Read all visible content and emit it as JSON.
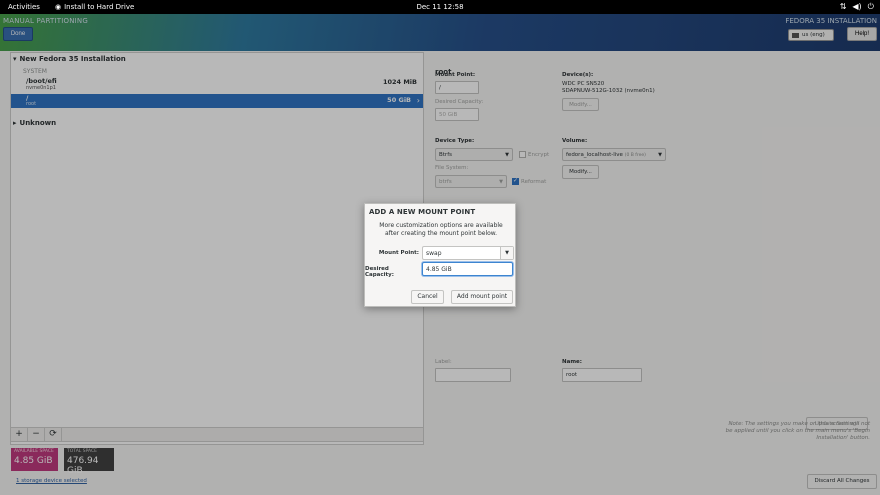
{
  "topbar": {
    "activities": "Activities",
    "app_name": "Install to Hard Drive",
    "clock": "Dec 11  12:58",
    "icons": [
      "network-icon",
      "volume-icon",
      "power-icon"
    ]
  },
  "header": {
    "section_title": "MANUAL PARTITIONING",
    "done_label": "Done",
    "product_title": "FEDORA 35 INSTALLATION",
    "keyboard_layout": "us (eng)",
    "help_label": "Help!"
  },
  "tree": {
    "install_title": "New Fedora 35 Installation",
    "system_label": "SYSTEM",
    "partitions": [
      {
        "mount": "/boot/efi",
        "device": "nvme0n1p1",
        "size": "1024 MiB"
      },
      {
        "mount": "/",
        "device": "root",
        "size": "50 GiB"
      }
    ],
    "unknown_label": "Unknown"
  },
  "toolbar": {
    "add": "+",
    "remove": "−",
    "refresh": "⟳"
  },
  "space": {
    "available_label": "AVAILABLE SPACE",
    "available_value": "4.85 GiB",
    "total_label": "TOTAL SPACE",
    "total_value": "476.94 GiB"
  },
  "storage_link": "1 storage device selected",
  "details": {
    "title": "root",
    "mount_point_label": "Mount Point:",
    "mount_point_value": "/",
    "desired_capacity_label": "Desired Capacity:",
    "desired_capacity_value": "50 GiB",
    "devices_label": "Device(s):",
    "devices_line1": "WDC PC SN520",
    "devices_line2": "SDAPNUW-512G-1032 (nvme0n1)",
    "modify_label": "Modify...",
    "device_type_label": "Device Type:",
    "device_type_value": "Btrfs",
    "encrypt_label": "Encrypt",
    "volume_label": "Volume:",
    "volume_value": "fedora_localhost-live",
    "volume_free": "(0 B free)",
    "volume_modify_label": "Modify...",
    "file_system_label": "File System:",
    "file_system_value": "btrfs",
    "reformat_label": "Reformat",
    "label_label": "Label:",
    "label_value": "",
    "name_label": "Name:",
    "name_value": "root",
    "update_label": "Update Settings",
    "note": "Note:  The settings you make on this screen will not be applied until you click on the main menu's 'Begin Installation' button.",
    "discard_label": "Discard All Changes"
  },
  "dialog": {
    "title": "ADD A NEW MOUNT POINT",
    "info_line1": "More customization options are available",
    "info_line2": "after creating the mount point below.",
    "mount_point_label": "Mount Point:",
    "mount_point_value": "swap",
    "capacity_label": "Desired Capacity:",
    "capacity_value": "4.85 GiB",
    "cancel_label": "Cancel",
    "add_label": "Add mount point"
  }
}
